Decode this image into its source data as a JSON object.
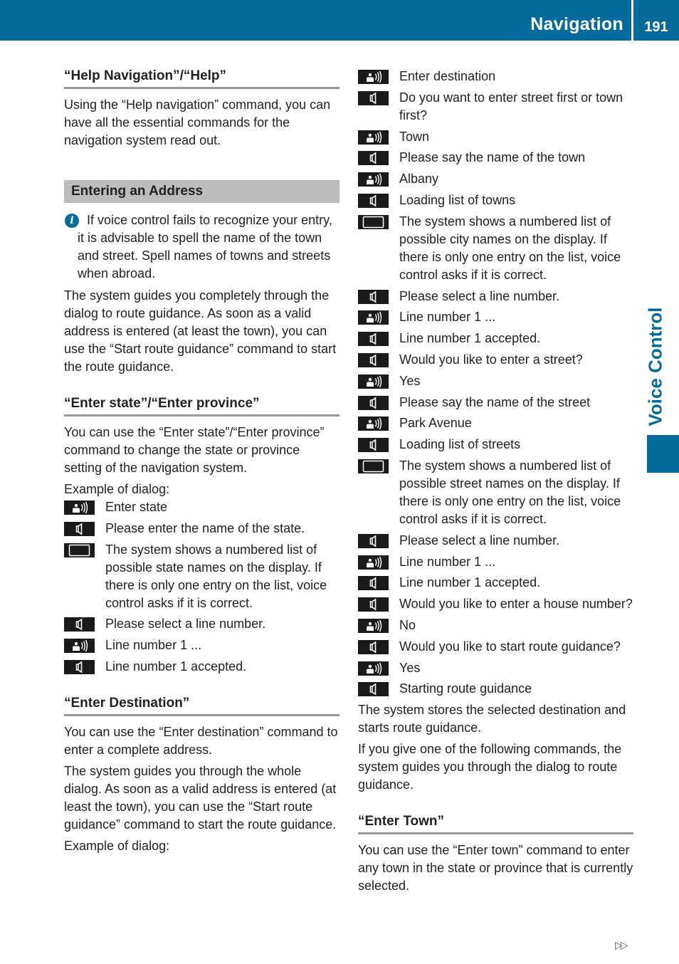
{
  "header": {
    "chapter": "Navigation",
    "page_number": "191",
    "side_tab": "Voice Control",
    "color_accent": "#046b9d"
  },
  "icons": {
    "user_speaks": "person-speaking-icon",
    "system_speaks": "speaker-icon",
    "display": "display-screen-icon",
    "info": "info-icon"
  },
  "left": {
    "help_heading": "“Help Navigation”/“Help”",
    "help_text": "Using the “Help navigation” command, you can have all the essential commands for the navigation system read out.",
    "address_band": "Entering an Address",
    "info_note": "If voice control fails to recognize your entry, it is advisable to spell the name of the town and street. Spell names of towns and streets when abroad.",
    "address_text": "The system guides you completely through the dialog to route guidance. As soon as a valid address is entered (at least the town), you can use the “Start route guidance” command to start the route guidance.",
    "state_heading": "“Enter state”/“Enter province”",
    "state_text": "You can use the “Enter state”/“Enter province” command to change the state or province setting of the navigation system.",
    "state_example": "Example of dialog:",
    "state_dialog": [
      {
        "type": "user",
        "text": "Enter state"
      },
      {
        "type": "system",
        "text": "Please enter the name of the state."
      },
      {
        "type": "display",
        "text": "The system shows a numbered list of possible state names on the display. If there is only one entry on the list, voice control asks if it is correct."
      },
      {
        "type": "system",
        "text": "Please select a line number."
      },
      {
        "type": "user",
        "text": "Line number 1 ..."
      },
      {
        "type": "system",
        "text": "Line number 1 accepted."
      }
    ],
    "dest_heading": "“Enter Destination”",
    "dest_text1": "You can use the “Enter destination” command to enter a complete address.",
    "dest_text2": "The system guides you through the whole dialog. As soon as a valid address is entered (at least the town), you can use the “Start route guidance” command to start the route guidance.",
    "dest_example": "Example of dialog:"
  },
  "right": {
    "dest_dialog": [
      {
        "type": "user",
        "text": "Enter destination"
      },
      {
        "type": "system",
        "text": "Do you want to enter street first or town first?"
      },
      {
        "type": "user",
        "text": "Town"
      },
      {
        "type": "system",
        "text": "Please say the name of the town"
      },
      {
        "type": "user",
        "text": "Albany"
      },
      {
        "type": "system",
        "text": "Loading list of towns"
      },
      {
        "type": "display",
        "text": "The system shows a numbered list of possible city names on the display. If there is only one entry on the list, voice control asks if it is correct."
      },
      {
        "type": "system",
        "text": "Please select a line number."
      },
      {
        "type": "user",
        "text": "Line number 1 ..."
      },
      {
        "type": "system",
        "text": "Line number 1 accepted."
      },
      {
        "type": "system",
        "text": "Would you like to enter a street?"
      },
      {
        "type": "user",
        "text": "Yes"
      },
      {
        "type": "system",
        "text": "Please say the name of the street"
      },
      {
        "type": "user",
        "text": "Park Avenue"
      },
      {
        "type": "system",
        "text": "Loading list of streets"
      },
      {
        "type": "display",
        "text": "The system shows a numbered list of possible street names on the display. If there is only one entry on the list, voice control asks if it is correct."
      },
      {
        "type": "system",
        "text": "Please select a line number."
      },
      {
        "type": "user",
        "text": "Line number 1 ..."
      },
      {
        "type": "system",
        "text": "Line number 1 accepted."
      },
      {
        "type": "system",
        "text": "Would you like to enter a house number?"
      },
      {
        "type": "user",
        "text": "No"
      },
      {
        "type": "system",
        "text": "Would you like to start route guidance?"
      },
      {
        "type": "user",
        "text": "Yes"
      },
      {
        "type": "system",
        "text": "Starting route guidance"
      }
    ],
    "stores_text": "The system stores the selected destination and starts route guidance.",
    "commands_text": "If you give one of the following commands, the system guides you through the dialog to route guidance.",
    "town_heading": "“Enter Town”",
    "town_text": "You can use the “Enter town” command to enter any town in the state or province that is currently selected."
  },
  "footer": {
    "continue_glyph": "▷▷",
    "continue_icon": "continued-arrow-icon"
  }
}
